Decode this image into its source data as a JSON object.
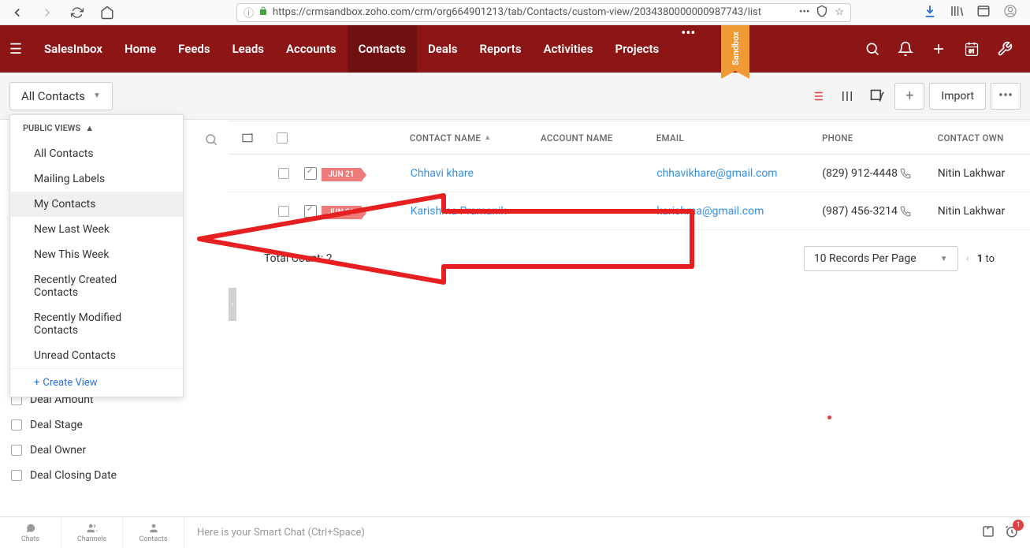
{
  "url": "https://crmsandbox.zoho.com/crm/org664901213/tab/Contacts/custom-view/2034380000000987743/list",
  "url_domain": ".zoho.com",
  "nav": {
    "items": [
      "SalesInbox",
      "Home",
      "Feeds",
      "Leads",
      "Accounts",
      "Contacts",
      "Deals",
      "Reports",
      "Activities",
      "Projects"
    ],
    "active": "Contacts",
    "sandbox_label": "Sandbox"
  },
  "toolbar": {
    "view_selector": "All Contacts",
    "import": "Import"
  },
  "dropdown": {
    "section": "PUBLIC VIEWS",
    "items": [
      "All Contacts",
      "Mailing Labels",
      "My Contacts",
      "New Last Week",
      "New This Week",
      "Recently Created Contacts",
      "Recently Modified Contacts",
      "Unread Contacts"
    ],
    "selected": "My Contacts",
    "create": "Create View"
  },
  "columns": {
    "name": "CONTACT NAME",
    "account": "ACCOUNT NAME",
    "email": "EMAIL",
    "phone": "PHONE",
    "owner": "CONTACT OWN"
  },
  "rows": [
    {
      "date_badge": "JUN 21",
      "name": "Chhavi khare",
      "account": "",
      "email": "chhavikhare@gmail.com",
      "phone": "(829) 912-4448",
      "owner": "Nitin Lakhwar"
    },
    {
      "date_badge": "JUN 21",
      "name": "Karishma Pramanik",
      "account": "",
      "email": "karishma@gmail.com",
      "phone": "(987) 456-3214",
      "owner": "Nitin Lakhwar"
    }
  ],
  "total_count": "Total Count: 2",
  "pager": {
    "per_page": "10 Records Per Page",
    "range": "1 to"
  },
  "filters": [
    "Deal Amount",
    "Deal Stage",
    "Deal Owner",
    "Deal Closing Date"
  ],
  "bottom": {
    "chats": "Chats",
    "channels": "Channels",
    "contacts": "Contacts",
    "smart_chat": "Here is your Smart Chat (Ctrl+Space)",
    "badge_count": "1"
  }
}
